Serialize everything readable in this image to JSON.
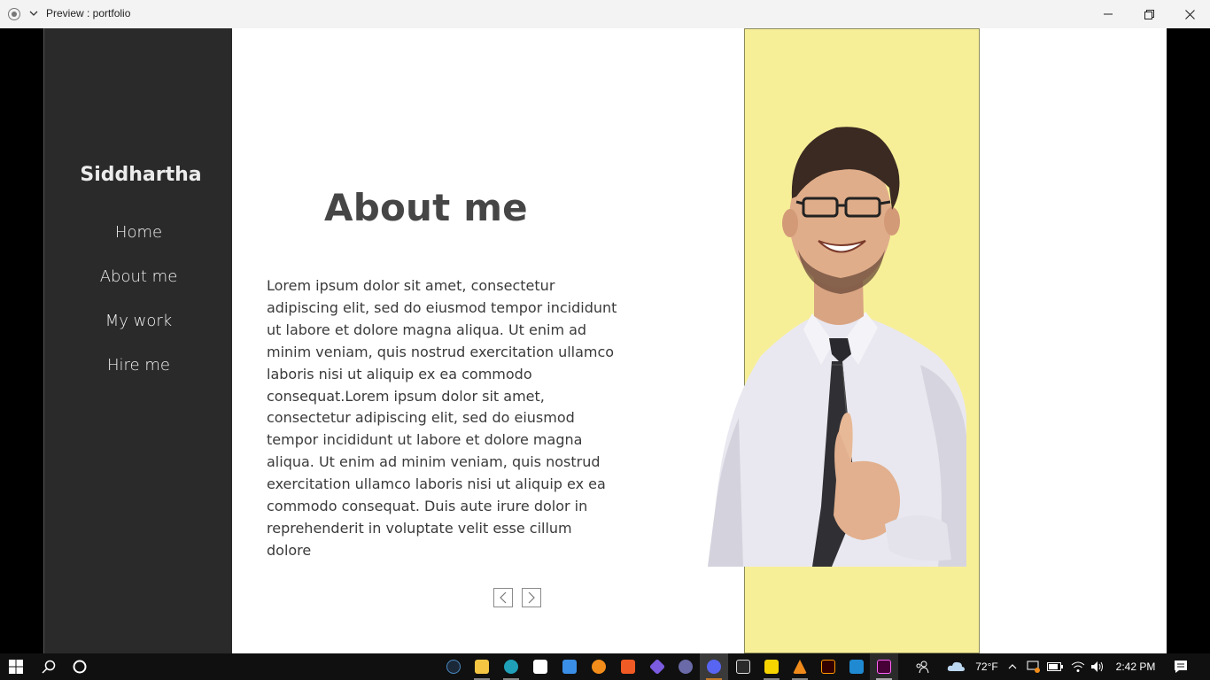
{
  "window": {
    "title": "Preview : portfolio"
  },
  "sidebar": {
    "brand": "Siddhartha",
    "items": [
      {
        "label": "Home"
      },
      {
        "label": "About me"
      },
      {
        "label": "My work"
      },
      {
        "label": "Hire me"
      }
    ]
  },
  "main": {
    "heading": "About me",
    "body_lines": [
      "Lorem ipsum dolor sit amet, consectetur",
      "adipiscing elit, sed do eiusmod tempor incididunt",
      "ut labore et dolore magna aliqua. Ut enim ad",
      "minim veniam, quis nostrud exercitation ullamco",
      "laboris nisi ut aliquip ex ea commodo",
      "consequat.Lorem ipsum dolor sit amet,",
      "consectetur adipiscing elit, sed do eiusmod",
      "tempor incididunt ut labore et dolore magna",
      "aliqua. Ut enim ad minim veniam, quis nostrud",
      "exercitation ullamco laboris nisi ut aliquip ex ea",
      "commodo consequat. Duis aute irure dolor in",
      "reprehenderit in voluptate velit esse cillum dolore"
    ],
    "prev_icon": "chevron-left-icon",
    "next_icon": "chevron-right-icon"
  },
  "colors": {
    "sidebar_bg": "#2a2a2a",
    "accent_yellow": "#f7ef98",
    "heading": "#464646"
  },
  "taskbar": {
    "weather": "72°F",
    "time": "2:42 PM",
    "apps": [
      "steam-icon",
      "file-explorer-icon",
      "edge-icon",
      "store-icon",
      "mail-icon",
      "search-everything-icon",
      "brave-icon",
      "obsidian-icon",
      "app-icon",
      "discord-icon",
      "epic-games-icon",
      "sticky-notes-icon",
      "vlc-icon",
      "illustrator-icon",
      "vscode-icon",
      "adobe-xd-icon"
    ]
  }
}
